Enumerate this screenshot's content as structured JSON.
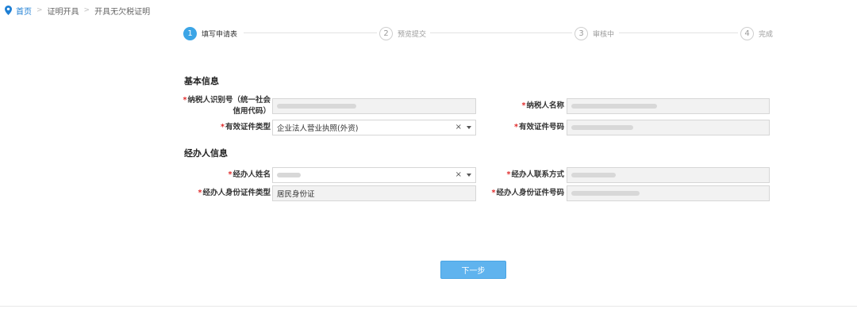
{
  "breadcrumb": {
    "home": "首页",
    "items": [
      "证明开具",
      "开具无欠税证明"
    ],
    "separator": ">"
  },
  "steps": [
    {
      "num": "1",
      "label": "填写申请表",
      "active": true
    },
    {
      "num": "2",
      "label": "预览提交",
      "active": false
    },
    {
      "num": "3",
      "label": "审核中",
      "active": false
    },
    {
      "num": "4",
      "label": "完成",
      "active": false
    }
  ],
  "sections": {
    "basic": "基本信息",
    "agent": "经办人信息"
  },
  "fields": {
    "taxpayer_id": {
      "label_line1": "纳税人识别号（统一社会",
      "label_line2": "信用代码）",
      "value": ""
    },
    "taxpayer_name": {
      "label": "纳税人名称",
      "value": ""
    },
    "cert_type": {
      "label": "有效证件类型",
      "value": "企业法人营业执照(外资)"
    },
    "cert_number": {
      "label": "有效证件号码",
      "value": ""
    },
    "agent_name": {
      "label": "经办人姓名",
      "value": ""
    },
    "agent_contact": {
      "label": "经办人联系方式",
      "value": ""
    },
    "agent_id_type": {
      "label": "经办人身份证件类型",
      "value": "居民身份证"
    },
    "agent_id_number": {
      "label": "经办人身份证件号码",
      "value": ""
    }
  },
  "required_mark": "*",
  "clear_symbol": "×",
  "next_button": "下一步",
  "colors": {
    "accent": "#3ca5e6",
    "required": "#e02a2a",
    "button": "#5fb3ee",
    "link": "#1e7fd4"
  }
}
